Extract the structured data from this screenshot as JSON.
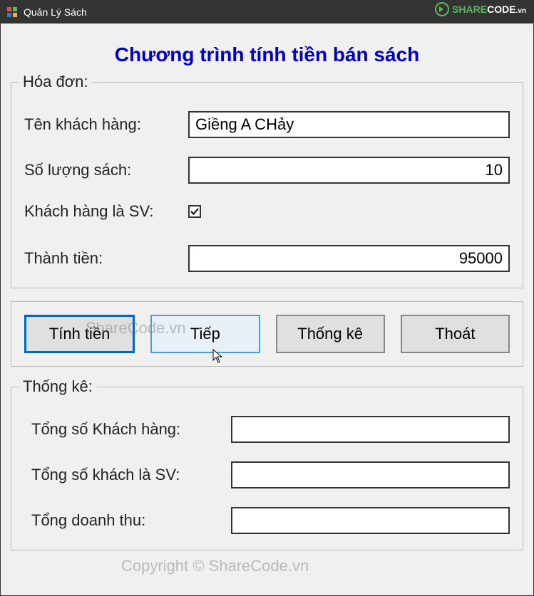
{
  "window": {
    "title": "Quản Lý Sách"
  },
  "header": {
    "main_title": "Chương trình tính tiền bán sách"
  },
  "invoice": {
    "legend": "Hóa đơn:",
    "customer_label": "Tên khách hàng:",
    "customer_value": "Giềng A CHảy",
    "qty_label": "Số lượng sách:",
    "qty_value": "10",
    "sv_label": "Khách hàng là SV:",
    "sv_checked": "☑",
    "total_label": "Thành tiền:",
    "total_value": "95000"
  },
  "buttons": {
    "calc": "Tính tiền",
    "next": "Tiếp",
    "stats": "Thống kê",
    "exit": "Thoát"
  },
  "stats": {
    "legend": "Thống kê:",
    "total_customers_label": "Tổng số Khách hàng:",
    "total_customers_value": "",
    "total_sv_label": "Tổng số khách là SV:",
    "total_sv_value": "",
    "total_revenue_label": "Tổng doanh thu:",
    "total_revenue_value": ""
  },
  "watermarks": {
    "wm1": "ShareCode.vn",
    "wm2": "Copyright © ShareCode.vn",
    "logo_text": "SHARECODE.vn"
  }
}
